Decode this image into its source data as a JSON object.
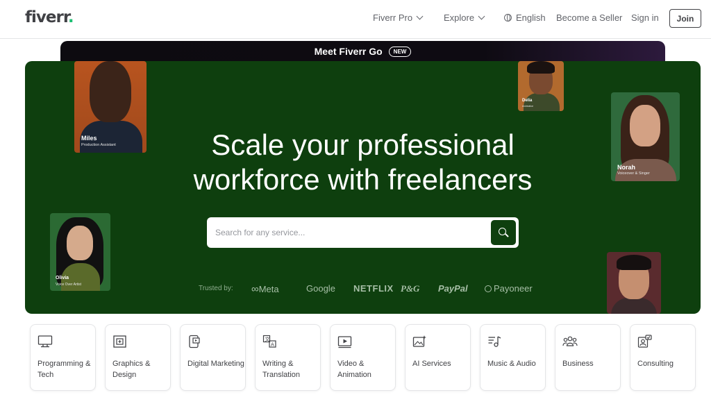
{
  "header": {
    "logo": "fiverr",
    "logo_dot": ".",
    "nav_pro": "Fiverr Pro",
    "nav_explore": "Explore",
    "nav_language": "English",
    "nav_seller": "Become a Seller",
    "nav_signin": "Sign in",
    "join": "Join"
  },
  "promo": {
    "text": "Meet Fiverr Go",
    "badge": "NEW"
  },
  "hero": {
    "title_line1": "Scale your professional",
    "title_line2": "workforce with freelancers",
    "search_placeholder": "Search for any service...",
    "trusted_by": "Trusted by:",
    "brands": [
      "Meta",
      "Google",
      "NETFLIX",
      "P&G",
      "PayPal",
      "Payoneer"
    ]
  },
  "portraits": [
    {
      "name": "Miles",
      "role": "Production Assistant"
    },
    {
      "name": "Delia",
      "role": "Animator"
    },
    {
      "name": "Norah",
      "role": "Voiceover & Singer"
    },
    {
      "name": "Olivia",
      "role": "Voice Over Artist"
    }
  ],
  "categories": [
    {
      "label": "Programming & Tech",
      "icon": "monitor-icon"
    },
    {
      "label": "Graphics & Design",
      "icon": "design-frame-icon"
    },
    {
      "label": "Digital Marketing",
      "icon": "phone-marketing-icon"
    },
    {
      "label": "Writing & Translation",
      "icon": "translation-icon"
    },
    {
      "label": "Video & Animation",
      "icon": "video-icon"
    },
    {
      "label": "AI Services",
      "icon": "ai-image-icon"
    },
    {
      "label": "Music & Audio",
      "icon": "music-icon"
    },
    {
      "label": "Business",
      "icon": "people-icon"
    },
    {
      "label": "Consulting",
      "icon": "consulting-icon"
    }
  ],
  "colors": {
    "brand_green": "#1dbf73",
    "hero_bg": "#0e3f0e",
    "text": "#404145"
  }
}
